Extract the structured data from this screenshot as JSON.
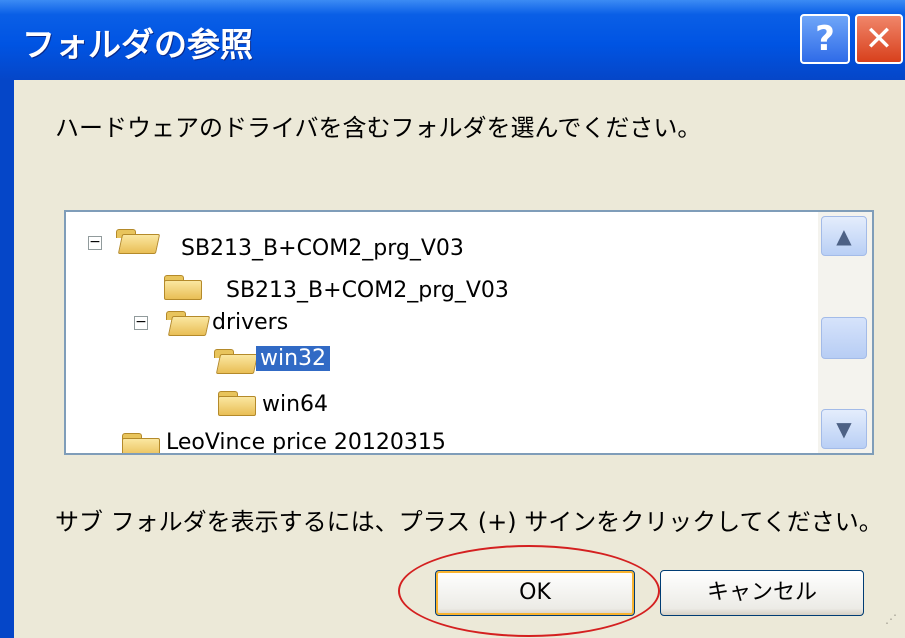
{
  "window": {
    "title": "フォルダの参照",
    "help_label": "?",
    "close_label": "✕"
  },
  "prompt": "ハードウェアのドライバを含むフォルダを選んでください。",
  "tree": {
    "nodes": [
      {
        "label": "SB213_B+COM2_prg_V03",
        "expander": "⊟"
      },
      {
        "label": "SB213_B+COM2_prg_V03"
      },
      {
        "label": "drivers",
        "expander": "⊟"
      },
      {
        "label": "win32",
        "selected": true
      },
      {
        "label": "win64"
      },
      {
        "label": "LeoVince price 20120315"
      }
    ],
    "scroll_up": "▲",
    "scroll_down": "▼"
  },
  "hint": "サブ フォルダを表示するには、プラス (+) サインをクリックしてください。",
  "buttons": {
    "ok": "OK",
    "cancel": "キャンセル"
  },
  "annotation_color": "#D42020",
  "selection_color": "#316AC5"
}
